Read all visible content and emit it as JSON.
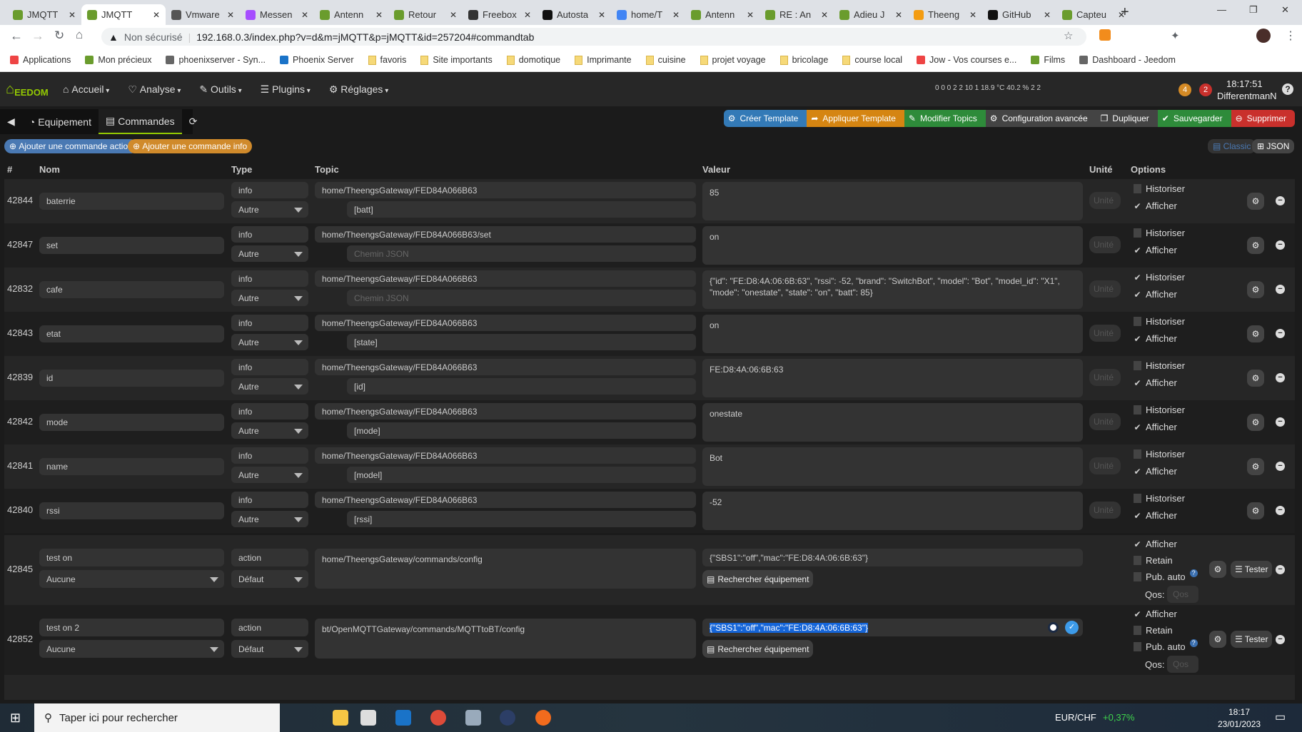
{
  "browser": {
    "tabs": [
      {
        "label": "JMQTT",
        "color": "#6a9c2d"
      },
      {
        "label": "JMQTT",
        "color": "#6a9c2d",
        "active": true
      },
      {
        "label": "Vmware",
        "color": "#555"
      },
      {
        "label": "Messen",
        "color": "#a64dff"
      },
      {
        "label": "Antenn",
        "color": "#6a9c2d"
      },
      {
        "label": "Retour",
        "color": "#6a9c2d"
      },
      {
        "label": "Freebox",
        "color": "#333"
      },
      {
        "label": "Autosta",
        "color": "#111"
      },
      {
        "label": "home/T",
        "color": "#4285f4"
      },
      {
        "label": "Antenn",
        "color": "#6a9c2d"
      },
      {
        "label": "RE : An",
        "color": "#6a9c2d"
      },
      {
        "label": "Adieu J",
        "color": "#6a9c2d"
      },
      {
        "label": "Theeng",
        "color": "#f39c12"
      },
      {
        "label": "GitHub",
        "color": "#111"
      },
      {
        "label": "Capteu",
        "color": "#6a9c2d"
      }
    ],
    "security": "Non sécurisé",
    "url": "192.168.0.3/index.php?v=d&m=jMQTT&p=jMQTT&id=257204#commandtab",
    "bookmarks": [
      "Applications",
      "Mon précieux",
      "phoenixserver - Syn...",
      "Phoenix Server",
      "favoris",
      "Site importants",
      "domotique",
      "Imprimante",
      "cuisine",
      "projet voyage",
      "bricolage",
      "course local",
      "Jow - Vos courses e...",
      "Films",
      "Dashboard - Jeedom"
    ]
  },
  "jeedom": {
    "logo": "EEDOM",
    "menu": [
      "Accueil",
      "Analyse",
      "Outils",
      "Plugins",
      "Réglages"
    ],
    "status": "0  0  0  2  2  10  1  18.9 °C  40.2 %  2  2",
    "badge_orange": "4",
    "badge_red": "2",
    "time": "18:17:51",
    "user": "DifferentmanN"
  },
  "tabs": {
    "equipment": "Equipement",
    "commands": "Commandes"
  },
  "actions": {
    "create_template": "Créer Template",
    "apply_template": "Appliquer Template",
    "modify_topics": "Modifier Topics",
    "advanced": "Configuration avancée",
    "duplicate": "Dupliquer",
    "save": "Sauvegarder",
    "delete": "Supprimer",
    "add_action": "Ajouter une commande action",
    "add_info": "Ajouter une commande info",
    "classic": "Classic",
    "json": "JSON"
  },
  "columns": {
    "id": "#",
    "name": "Nom",
    "type": "Type",
    "topic": "Topic",
    "value": "Valeur",
    "unit": "Unité",
    "options": "Options"
  },
  "labels": {
    "unit_placeholder": "Unité",
    "json_placeholder": "Chemin JSON",
    "historiser": "Historiser",
    "afficher": "Afficher",
    "retain": "Retain",
    "pub_auto": "Pub. auto",
    "qos": "Qos:",
    "qos_placeholder": "Qos",
    "search_eq": "Rechercher équipement",
    "tester": "Tester"
  },
  "info_rows": [
    {
      "id": "42844",
      "name": "baterrie",
      "type": "info",
      "subtype": "Autre",
      "topic": "home/TheengsGateway/FED84A066B63",
      "json": "[batt]",
      "value": "85",
      "historiser": false,
      "afficher": true
    },
    {
      "id": "42847",
      "name": "set",
      "type": "info",
      "subtype": "Autre",
      "topic": "home/TheengsGateway/FED84A066B63/set",
      "json": "",
      "value": "on",
      "historiser": false,
      "afficher": true
    },
    {
      "id": "42832",
      "name": "cafe",
      "type": "info",
      "subtype": "Autre",
      "topic": "home/TheengsGateway/FED84A066B63",
      "json": "",
      "value": "{\"id\": \"FE:D8:4A:06:6B:63\", \"rssi\": -52, \"brand\": \"SwitchBot\", \"model\": \"Bot\", \"model_id\": \"X1\", \"mode\": \"onestate\", \"state\": \"on\", \"batt\": 85}",
      "historiser": true,
      "afficher": true
    },
    {
      "id": "42843",
      "name": "etat",
      "type": "info",
      "subtype": "Autre",
      "topic": "home/TheengsGateway/FED84A066B63",
      "json": "[state]",
      "value": "on",
      "historiser": false,
      "afficher": true
    },
    {
      "id": "42839",
      "name": "id",
      "type": "info",
      "subtype": "Autre",
      "topic": "home/TheengsGateway/FED84A066B63",
      "json": "[id]",
      "value": "FE:D8:4A:06:6B:63",
      "historiser": false,
      "afficher": true
    },
    {
      "id": "42842",
      "name": "mode",
      "type": "info",
      "subtype": "Autre",
      "topic": "home/TheengsGateway/FED84A066B63",
      "json": "[mode]",
      "value": "onestate",
      "historiser": false,
      "afficher": true
    },
    {
      "id": "42841",
      "name": "name",
      "type": "info",
      "subtype": "Autre",
      "topic": "home/TheengsGateway/FED84A066B63",
      "json": "[model]",
      "value": "Bot",
      "historiser": false,
      "afficher": true
    },
    {
      "id": "42840",
      "name": "rssi",
      "type": "info",
      "subtype": "Autre",
      "topic": "home/TheengsGateway/FED84A066B63",
      "json": "[rssi]",
      "value": "-52",
      "historiser": false,
      "afficher": true
    }
  ],
  "action_rows": [
    {
      "id": "42845",
      "name": "test on",
      "linked": "Aucune",
      "type": "action",
      "subtype": "Défaut",
      "topic": "home/TheengsGateway/commands/config",
      "value": "{\"SBS1\":\"off\",\"mac\":\"FE:D8:4A:06:6B:63\"}",
      "afficher": true,
      "retain": false,
      "pub_auto": false
    },
    {
      "id": "42852",
      "name": "test on 2",
      "linked": "Aucune",
      "type": "action",
      "subtype": "Défaut",
      "topic": "bt/OpenMQTTGateway/commands/MQTTtoBT/config",
      "value": "{\"SBS1\":\"off\",\"mac\":\"FE:D8:4A:06:6B:63\"}",
      "afficher": true,
      "retain": false,
      "pub_auto": false,
      "selected": true
    }
  ],
  "taskbar": {
    "search": "Taper ici pour rechercher",
    "ticker": "EUR/CHF",
    "ticker_change": "+0,37%",
    "time": "18:17",
    "date": "23/01/2023"
  }
}
